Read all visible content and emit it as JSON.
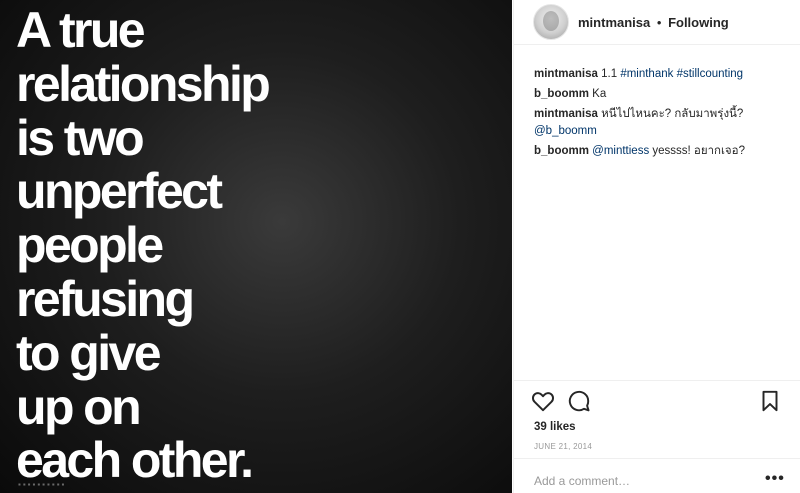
{
  "post": {
    "quote_lines": [
      "A true",
      "relationship",
      "is two",
      "unperfect",
      "people",
      "refusing",
      "to give",
      "up on",
      "each other."
    ]
  },
  "header": {
    "username": "mintmanisa",
    "separator": "•",
    "follow_status": "Following"
  },
  "comments": [
    {
      "user": "mintmanisa",
      "segments": [
        {
          "text": "1.1 ",
          "tag": false
        },
        {
          "text": "#minthank",
          "tag": true
        },
        {
          "text": " ",
          "tag": false
        },
        {
          "text": "#stillcounting",
          "tag": true
        }
      ]
    },
    {
      "user": "b_boomm",
      "segments": [
        {
          "text": "Ka",
          "tag": false
        }
      ]
    },
    {
      "user": "mintmanisa",
      "segments": [
        {
          "text": "หนีไปไหนคะ? กลับมาพรุ่งนี้?",
          "tag": false
        },
        {
          "text": "@b_boomm",
          "tag": true,
          "newline": true
        }
      ]
    },
    {
      "user": "b_boomm",
      "segments": [
        {
          "text": "@minttiess",
          "tag": true
        },
        {
          "text": " yessss! อยากเจอ?",
          "tag": false
        }
      ]
    }
  ],
  "actions": {
    "like_icon": "heart-icon",
    "comment_icon": "comment-icon",
    "save_icon": "bookmark-icon"
  },
  "likes": "39 likes",
  "date": "JUNE 21, 2014",
  "add_comment": {
    "placeholder": "Add a comment…"
  },
  "more_label": "•••",
  "colors": {
    "link": "#003569",
    "text": "#262626",
    "muted": "#999999",
    "border": "#efefef"
  }
}
